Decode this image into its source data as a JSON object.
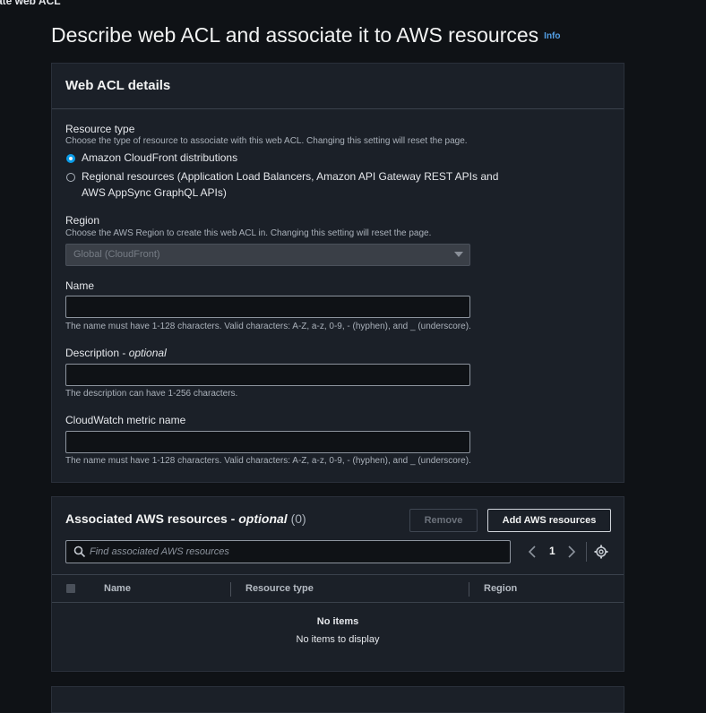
{
  "breadcrumb": "ate web ACL",
  "page": {
    "title": "Describe web ACL and associate it to AWS resources",
    "info_link": "Info"
  },
  "details_panel": {
    "title": "Web ACL details",
    "resource_type": {
      "label": "Resource type",
      "hint": "Choose the type of resource to associate with this web ACL. Changing this setting will reset the page.",
      "options": [
        {
          "label": "Amazon CloudFront distributions",
          "checked": true
        },
        {
          "label_line1": "Regional resources (Application Load Balancers, Amazon API Gateway REST APIs and",
          "label_line2": "AWS AppSync GraphQL APIs)",
          "checked": false
        }
      ]
    },
    "region": {
      "label": "Region",
      "hint": "Choose the AWS Region to create this web ACL in. Changing this setting will reset the page.",
      "value": "Global (CloudFront)"
    },
    "name": {
      "label": "Name",
      "value": "",
      "hint": "The name must have 1-128 characters. Valid characters: A-Z, a-z, 0-9, - (hyphen), and _ (underscore)."
    },
    "description": {
      "label": "Description",
      "label_suffix": "optional",
      "value": "",
      "hint": "The description can have 1-256 characters."
    },
    "metric": {
      "label": "CloudWatch metric name",
      "value": "",
      "hint": "The name must have 1-128 characters. Valid characters: A-Z, a-z, 0-9, - (hyphen), and _ (underscore)."
    }
  },
  "resources_panel": {
    "title": "Associated AWS resources",
    "title_suffix": "optional",
    "count": "(0)",
    "remove_label": "Remove",
    "add_label": "Add AWS resources",
    "search_placeholder": "Find associated AWS resources",
    "page_number": "1",
    "columns": [
      "Name",
      "Resource type",
      "Region"
    ],
    "empty_title": "No items",
    "empty_text": "No items to display"
  },
  "colors": {
    "accent": "#0a9ce8",
    "link": "#539fe5",
    "background": "#0f1216",
    "panel": "#1b2028"
  }
}
